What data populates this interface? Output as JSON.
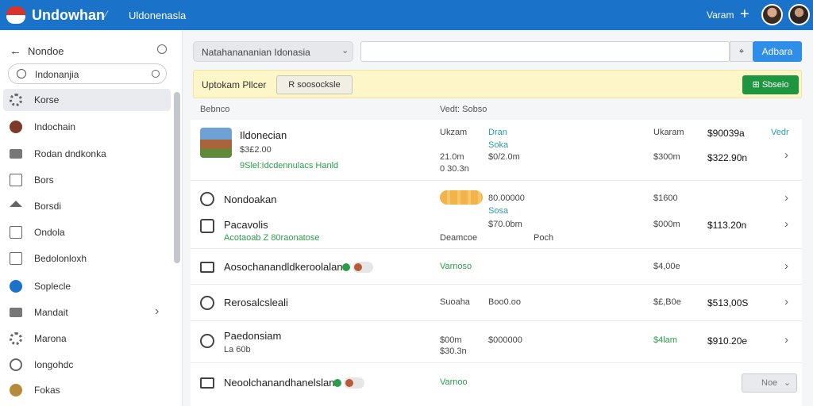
{
  "topbar": {
    "brand": "Undowhan",
    "brand_mark": "⁄",
    "subtitle": "Uldonenasla",
    "user_label": "Varam",
    "plus": "+"
  },
  "sidebar": {
    "back_label": "Nondoe",
    "back_arrow": "←",
    "search_value": "Indonanjia",
    "items": [
      {
        "label": "Korse",
        "icon": "gear-icon",
        "active": true
      },
      {
        "label": "Indochain",
        "icon": "flag-circle-icon"
      },
      {
        "label": "Rodan dndkonka",
        "icon": "folder-icon"
      },
      {
        "label": "Bors",
        "icon": "document-icon"
      },
      {
        "label": "Borsdi",
        "icon": "house-icon"
      },
      {
        "label": "Ondola",
        "icon": "grid-icon"
      },
      {
        "label": "Bedolonloxh",
        "icon": "table-icon"
      },
      {
        "label": "Soplecle",
        "icon": "blue-circle-icon"
      },
      {
        "label": "Mandait",
        "icon": "folder-icon",
        "chevron": "›"
      },
      {
        "label": "Marona",
        "icon": "gear-icon"
      },
      {
        "label": "Iongohdc",
        "icon": "circle-icon"
      },
      {
        "label": "Fokas",
        "icon": "gold-circle-icon"
      }
    ]
  },
  "toolbar": {
    "filter_value": "Natahanananian Idonasia",
    "filter_chevron": "⌄",
    "search_button": "⌖",
    "blue_button": "Adbara"
  },
  "banner": {
    "title": "Uptokam Pllcer",
    "button": "R soosocksle",
    "green_button": "Sbseio",
    "green_icon": "⊞"
  },
  "columns": {
    "c1": "Bebnco",
    "c2": "Vedt: Sobso"
  },
  "rows": [
    {
      "name": "Ildonecian",
      "sub1": "$3£2.00",
      "sub2": "9Slel:Idcdennulacs Hanld",
      "c_a1": "Ukzam",
      "c_a2": "21.0m",
      "c_a3": "0 30.3n",
      "c_b1": "Dran",
      "c_b2": "Soka",
      "c_b3": "$0/2.0m",
      "c_c1": "Ukaram",
      "c_c2": "$300m",
      "c_d1": "$90039a",
      "c_d2": "$322.90n",
      "c_e1": "Vedr"
    },
    {
      "name": "Nondoakan",
      "c_b1": "80.00000",
      "c_b2": "Sosa",
      "c_c1": "$1600"
    },
    {
      "name": "Pacavolis",
      "sub1": "Acotaoab Z 80raonatose",
      "c_a1": "Deamcoe",
      "c_b1": "$70.0bm",
      "c_b2": "Poch",
      "c_c1": "$000m",
      "c_d1": "$113.20n"
    },
    {
      "name": "Aosochanandldkeroolalan",
      "c_a1": "Varnoso",
      "c_c1": "$4,00e"
    },
    {
      "name": "Rerosalcsleali",
      "c_a1": "Suoaha",
      "c_b1": "Boo0.oo",
      "c_c1": "$£,B0e",
      "c_d1": "$513,00S"
    },
    {
      "name": "Paedonsiam",
      "sub1": "La 60b",
      "c_a1": "$00m",
      "c_a2": "$30.3n",
      "c_b1": "$000000",
      "c_c1": "$4lam",
      "c_d1": "$910.20e"
    },
    {
      "name": "Neoolchanandhanelslan",
      "c_a1": "Varnoo",
      "btn": "Noe"
    }
  ],
  "chevron_right": "›",
  "chevron_down": "⌄",
  "colors": {
    "topbar": "#1a73c9",
    "primary_button": "#2f8ee8",
    "green": "#1e9640",
    "banner": "#fdf6c8"
  }
}
